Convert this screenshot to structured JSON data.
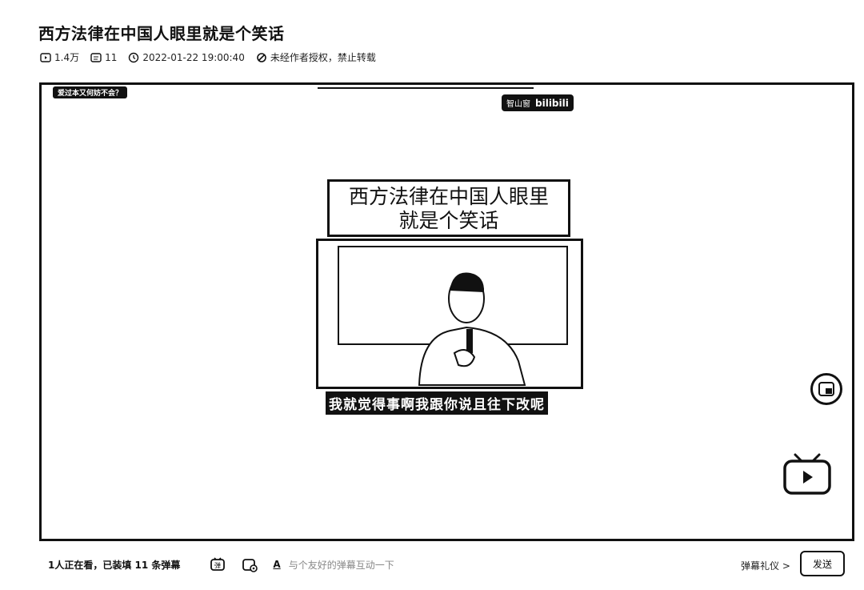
{
  "video": {
    "title": "西方法律在中国人眼里就是个笑话",
    "plays": "1.4万",
    "danmaku_count": "11",
    "publish_time": "2022-01-22 19:00:40",
    "copyright": "未经作者授权，禁止转载"
  },
  "player": {
    "watermark_left": "爱过本又何妨不会？",
    "watermark_right_label": "智山窗",
    "watermark_right_brand": "bilibili",
    "frame_title_line1": "西方法律在中国人眼里",
    "frame_title_line2": "就是个笑话",
    "subtitle": "我就觉得事啊我跟你说且往下改呢"
  },
  "bottom_bar": {
    "viewers": "1人正在看，已装填 11 条弹幕",
    "input_placeholder": "与个友好的弹幕互动一下",
    "font_icon": "A",
    "etiquette": "弹幕礼仪 >",
    "send": "发送"
  },
  "icons": {
    "plays": "play-icon",
    "danmaku": "danmaku-icon",
    "time": "clock-icon",
    "copyright": "forbidden-icon",
    "pip": "picture-in-picture-icon",
    "tv": "bilibili-tv-icon",
    "danmaku_toggle": "danmaku-toggle-icon",
    "danmaku_settings": "danmaku-settings-icon"
  }
}
